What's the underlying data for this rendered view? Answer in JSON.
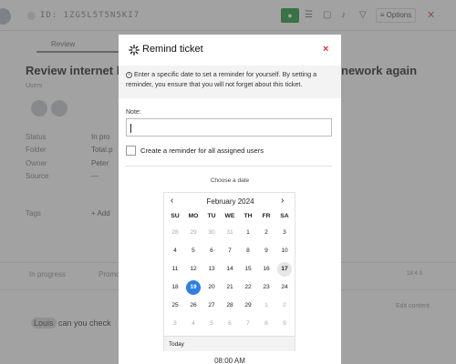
{
  "background": {
    "ticket_id": "ID: 1ZG5L5T5N5KI7",
    "options_label": "Options",
    "tab_review": "Review",
    "title_left": "Review internet b",
    "title_right": "nework again",
    "users_label": "Users",
    "fields": [
      {
        "label": "Status",
        "value": "In pro"
      },
      {
        "label": "Folder",
        "value": "Total.p"
      },
      {
        "label": "Owner",
        "value": "Peter"
      },
      {
        "label": "Source",
        "value": "—"
      }
    ],
    "tags_label": "Tags",
    "tags_add": "+ Add",
    "status_in_progress": "In progress",
    "status_promo": "Promo",
    "row_time": "18:4 S",
    "edit_content": "Edit content",
    "comment_user": "Louis",
    "comment_text": "can you check"
  },
  "modal": {
    "title": "Remind ticket",
    "close_glyph": "×",
    "info_text": "Enter a specific date to set a reminder for yourself. By setting a reminder, you ensure that you will not forget about this ticket.",
    "note_label": "Note:",
    "note_value": "",
    "checkbox_label": "Create a reminder for all assigned users",
    "choose_date_label": "Choose a date",
    "time_value": "08:00 AM"
  },
  "calendar": {
    "month_label": "February 2024",
    "prev_glyph": "‹",
    "next_glyph": "›",
    "weekdays": [
      "SU",
      "MO",
      "TU",
      "WE",
      "TH",
      "FR",
      "SA"
    ],
    "weeks": [
      [
        {
          "d": "28",
          "muted": true
        },
        {
          "d": "29",
          "muted": true
        },
        {
          "d": "30",
          "muted": true
        },
        {
          "d": "31",
          "muted": true
        },
        {
          "d": "1"
        },
        {
          "d": "2"
        },
        {
          "d": "3"
        }
      ],
      [
        {
          "d": "4"
        },
        {
          "d": "5"
        },
        {
          "d": "6"
        },
        {
          "d": "7"
        },
        {
          "d": "8"
        },
        {
          "d": "9"
        },
        {
          "d": "10"
        }
      ],
      [
        {
          "d": "11"
        },
        {
          "d": "12"
        },
        {
          "d": "13"
        },
        {
          "d": "14"
        },
        {
          "d": "15"
        },
        {
          "d": "16"
        },
        {
          "d": "17",
          "today": true
        }
      ],
      [
        {
          "d": "18"
        },
        {
          "d": "19",
          "selected": true
        },
        {
          "d": "20"
        },
        {
          "d": "21"
        },
        {
          "d": "22"
        },
        {
          "d": "23"
        },
        {
          "d": "24"
        }
      ],
      [
        {
          "d": "25"
        },
        {
          "d": "26"
        },
        {
          "d": "27"
        },
        {
          "d": "28"
        },
        {
          "d": "29"
        },
        {
          "d": "1",
          "muted": true
        },
        {
          "d": "2",
          "muted": true
        }
      ],
      [
        {
          "d": "3",
          "muted": true
        },
        {
          "d": "4",
          "muted": true
        },
        {
          "d": "5",
          "muted": true
        },
        {
          "d": "6",
          "muted": true
        },
        {
          "d": "7",
          "muted": true
        },
        {
          "d": "8",
          "muted": true
        },
        {
          "d": "9",
          "muted": true
        }
      ]
    ],
    "today_label": "Today",
    "selected_color": "#2f7fe0"
  },
  "colors": {
    "close_red": "#e03131",
    "overlay": "rgba(70,70,70,0.5)"
  }
}
